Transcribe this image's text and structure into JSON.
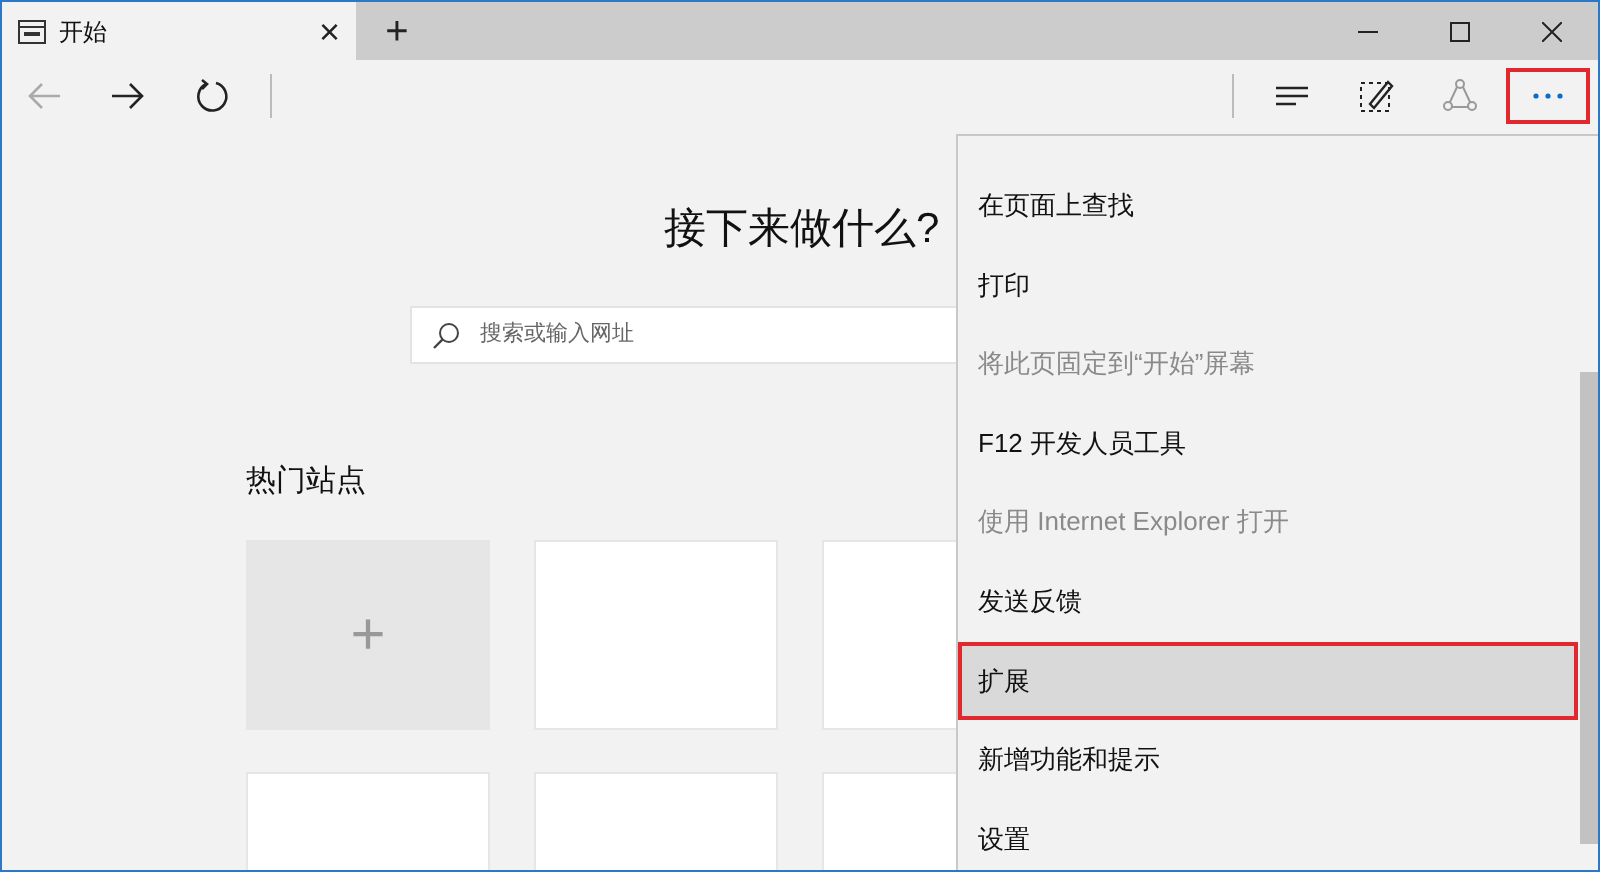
{
  "tab": {
    "title": "开始",
    "close": "×",
    "new_tab": "+"
  },
  "page": {
    "heading": "接下来做什么?",
    "search": {
      "placeholder": "搜索或输入网址"
    },
    "top_sites_title": "热门站点",
    "tiles": [
      {
        "kind": "add",
        "label": "+"
      },
      {
        "kind": "empty"
      },
      {
        "kind": "empty"
      },
      {
        "kind": "empty"
      },
      {
        "kind": "empty"
      },
      {
        "kind": "empty"
      }
    ]
  },
  "menu": {
    "items": [
      {
        "label": "在页面上查找",
        "disabled": false,
        "selected": false
      },
      {
        "label": "打印",
        "disabled": false,
        "selected": false
      },
      {
        "label": "将此页固定到“开始”屏幕",
        "disabled": true,
        "selected": false
      },
      {
        "label": "F12 开发人员工具",
        "disabled": false,
        "selected": false
      },
      {
        "label": "使用 Internet Explorer 打开",
        "disabled": true,
        "selected": false
      },
      {
        "label": "发送反馈",
        "disabled": false,
        "selected": false
      },
      {
        "label": "扩展",
        "disabled": false,
        "selected": true
      },
      {
        "label": "新增功能和提示",
        "disabled": false,
        "selected": false
      },
      {
        "label": "设置",
        "disabled": false,
        "selected": false
      }
    ]
  }
}
